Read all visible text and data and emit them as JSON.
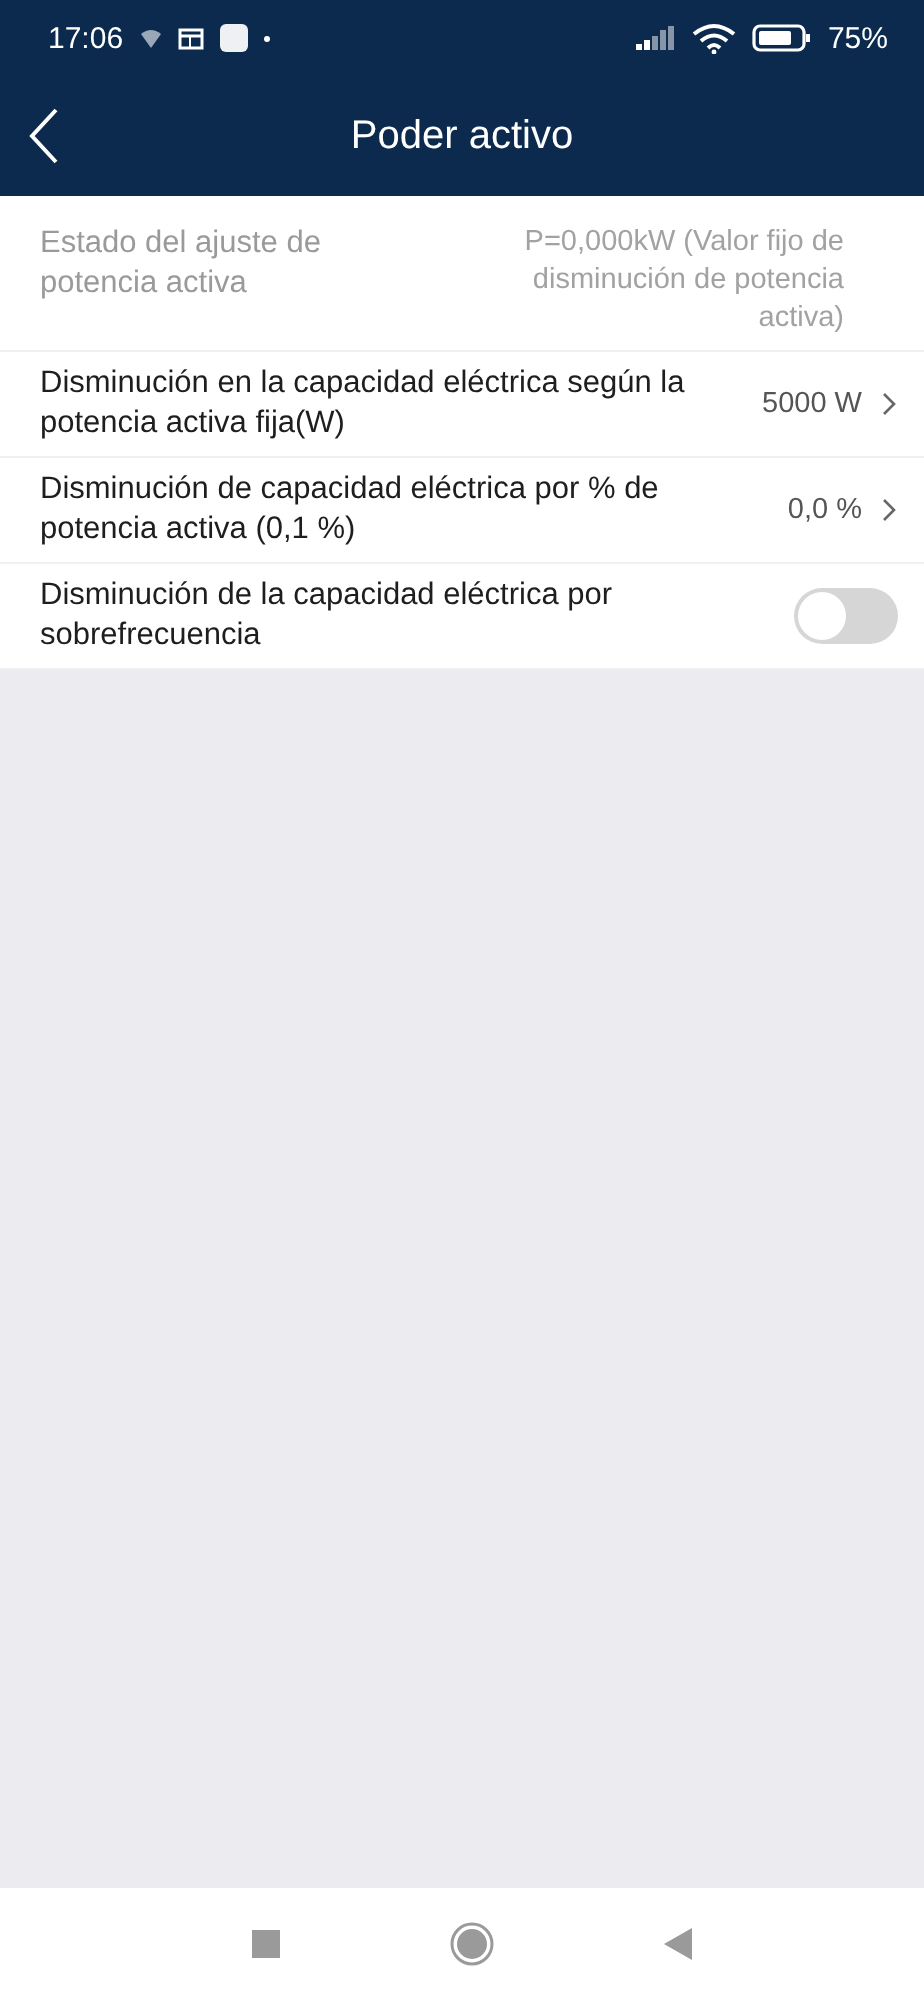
{
  "status_bar": {
    "time": "17:06",
    "battery": "75%"
  },
  "header": {
    "title": "Poder activo"
  },
  "settings": [
    {
      "kind": "info",
      "label": "Estado del ajuste de potencia activa",
      "value": "P=0,000kW (Valor fijo de disminución de potencia activa)"
    },
    {
      "kind": "value",
      "label": "Disminución en la capacidad eléctrica según la potencia activa fija(W)",
      "value": "5000 W"
    },
    {
      "kind": "value",
      "label": "Disminución de capacidad eléctrica por % de potencia activa (0,1 %)",
      "value": "0,0 %"
    },
    {
      "kind": "toggle",
      "label": "Disminución de la capacidad eléctrica por sobrefrecuencia",
      "on": false
    }
  ]
}
